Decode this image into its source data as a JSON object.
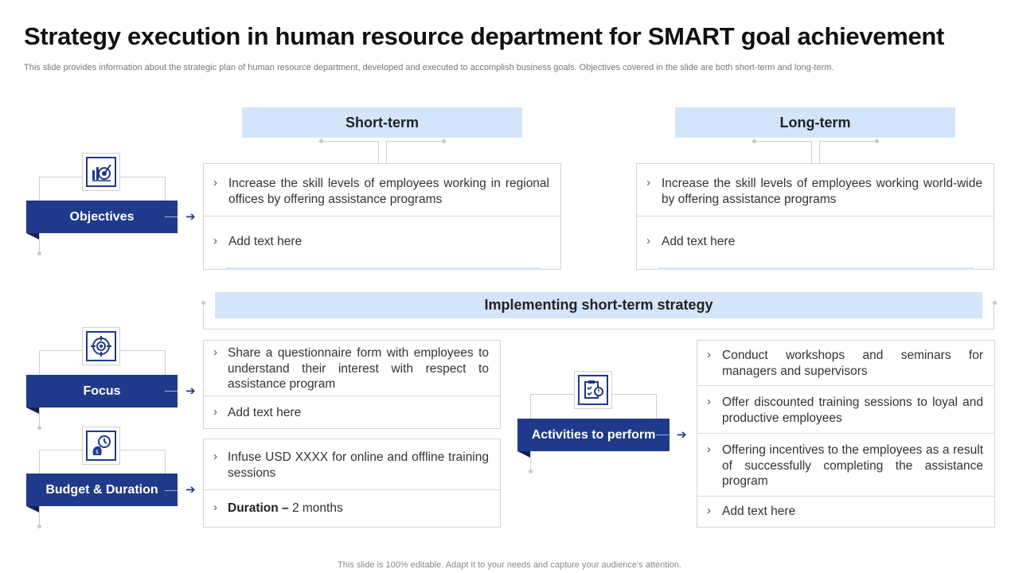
{
  "title": "Strategy execution in human resource department for SMART goal achievement",
  "subtitle": "This slide provides information about the strategic plan of human resource department, developed and executed to accomplish business goals. Objectives covered in the slide are both short-term and long-term.",
  "footer": "This slide is 100% editable. Adapt it to your needs and capture your audience's attention.",
  "bullet_glyph": "›",
  "arrow_glyph": "➔",
  "colors": {
    "navy": "#1f3a8a",
    "light_blue": "#d4e5fb"
  },
  "headers": {
    "short_term": "Short-term",
    "long_term": "Long-term",
    "implementing": "Implementing short-term strategy"
  },
  "sections": {
    "objectives": {
      "label": "Objectives",
      "icon": "target-chart-icon"
    },
    "focus": {
      "label": "Focus",
      "icon": "crosshair-target-icon"
    },
    "budget": {
      "label": "Budget & Duration",
      "icon": "money-clock-icon"
    },
    "activities": {
      "label": "Activities to perform",
      "icon": "checklist-icon"
    }
  },
  "short_term_items": [
    "Increase the skill levels of employees working in regional offices by offering assistance programs",
    "Add text here"
  ],
  "long_term_items": [
    "Increase the skill levels of employees working world-wide by offering assistance programs",
    "Add text here"
  ],
  "focus_items": [
    "Share a questionnaire form with employees to understand their interest with respect to assistance program",
    "Add text here"
  ],
  "budget_items": {
    "budget": "Infuse USD XXXX for online and offline training sessions",
    "duration_label": "Duration –",
    "duration_value": " 2 months"
  },
  "activity_items": [
    "Conduct workshops and seminars for managers and supervisors",
    "Offer discounted training sessions to loyal and productive employees",
    "Offering incentives to the employees as a result of successfully completing the assistance program",
    "Add text here"
  ]
}
